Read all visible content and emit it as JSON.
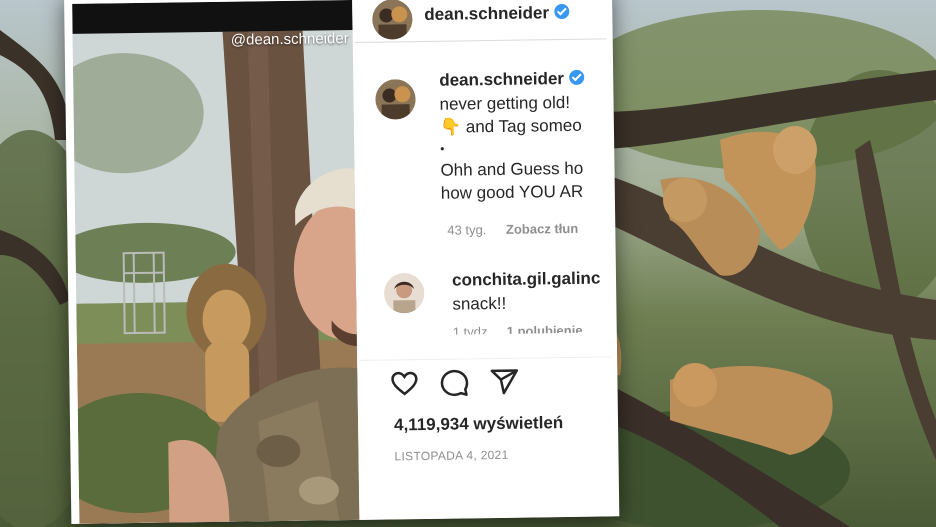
{
  "photo": {
    "watermark": "@dean.schneider"
  },
  "sidebar": {
    "header": {
      "username": "dean.schneider",
      "verified_icon": "verified-badge-icon",
      "avatar_icon": "profile-avatar-icon"
    },
    "caption": {
      "username": "dean.schneider",
      "lines": [
        "never getting old!",
        "👇 and Tag someo",
        "•",
        "Ohh and Guess ho",
        "how good YOU AR"
      ],
      "age": "43 tyg.",
      "translate": "Zobacz tłun"
    },
    "comment": {
      "username": "conchita.gil.galinc",
      "text": "snack!!",
      "age": "1 tydz.",
      "likes": "1 polubienie"
    },
    "actions": {
      "like_icon": "heart-icon",
      "comment_icon": "comment-icon",
      "share_icon": "send-icon",
      "views": "4,119,934 wyświetleń",
      "date": "LISTOPADA 4, 2021"
    }
  },
  "colors": {
    "verified": "#3897f0",
    "text": "#262626",
    "muted": "#8e8e8e"
  }
}
